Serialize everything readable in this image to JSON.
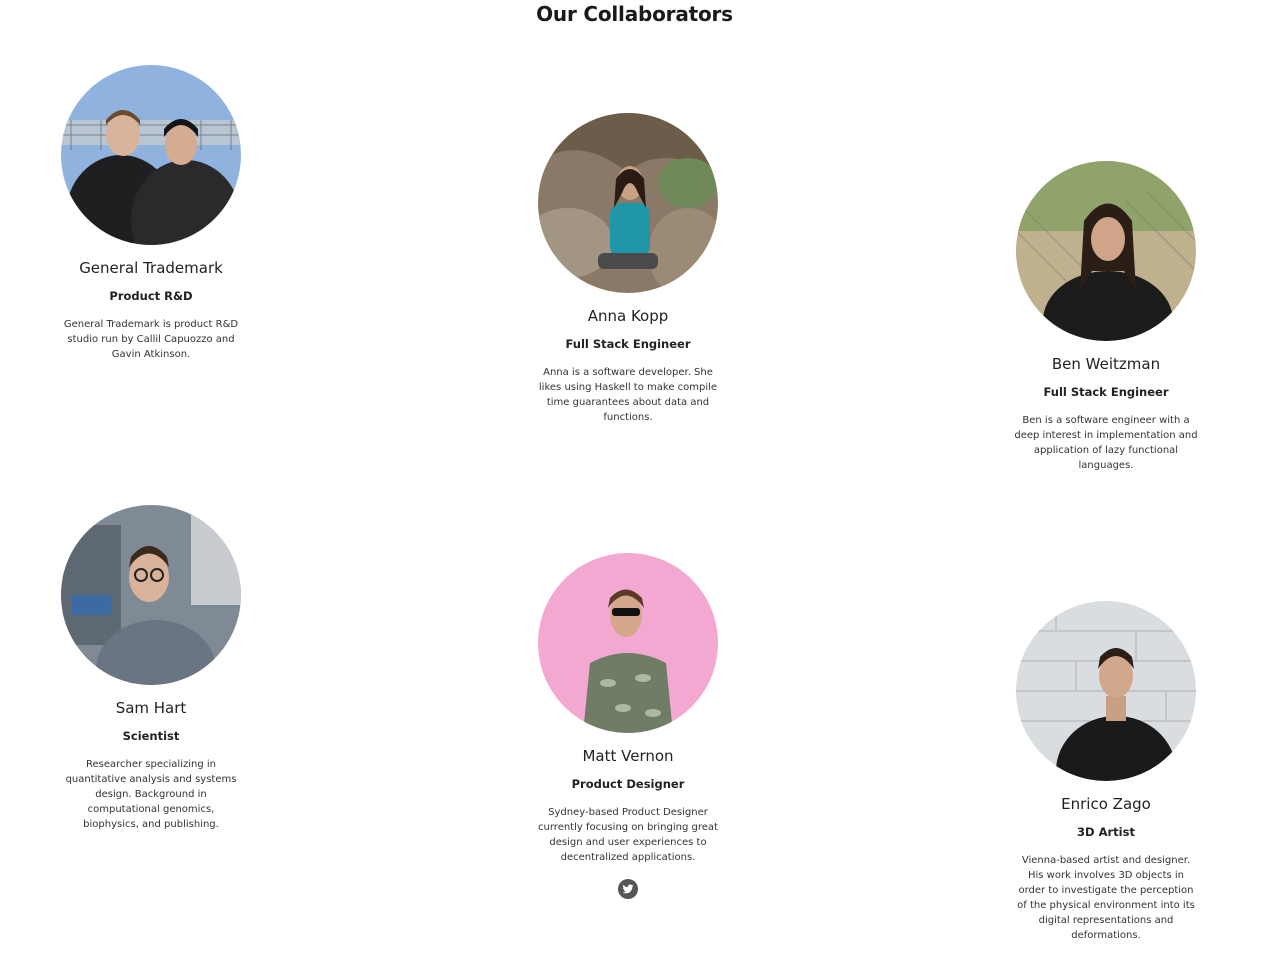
{
  "page": {
    "title": "Our Collaborators"
  },
  "collaborators": [
    {
      "name": "General Trademark",
      "role": "Product R&D",
      "bio": "General Trademark is product R&D studio run by Callil Capuozzo and Gavin Atkinson.",
      "photo": {
        "bg": "#7ea6d6",
        "accent": "#2a2a2a"
      }
    },
    {
      "name": "Anna Kopp",
      "role": "Full Stack Engineer",
      "bio": "Anna is a software developer. She likes using Haskell to make compile time guarantees about data and functions.",
      "photo": {
        "bg": "#8d7c6a",
        "accent": "#1f8f9e"
      }
    },
    {
      "name": "Ben Weitzman",
      "role": "Full Stack Engineer",
      "bio": "Ben is a software engineer with a deep interest in implementation and application of lazy functional languages.",
      "photo": {
        "bg": "#b7a888",
        "accent": "#2a2a2a"
      }
    },
    {
      "name": "Sam Hart",
      "role": "Scientist",
      "bio": "Researcher specializing in quantitative analysis and systems design. Background in computational genomics, biophysics, and publishing.",
      "photo": {
        "bg": "#7e8791",
        "accent": "#6f7a86"
      }
    },
    {
      "name": "Matt Vernon",
      "role": "Product Designer",
      "bio": "Sydney-based Product Designer currently focusing on bringing great design and user experiences to decentralized applications.",
      "photo": {
        "bg": "#f2a6d0",
        "accent": "#6f7d66"
      },
      "social": "twitter-icon"
    },
    {
      "name": "Enrico Zago",
      "role": "3D Artist",
      "bio": "Vienna-based artist and designer. His work involves 3D objects in order to investigate the perception of the physical environment into its digital representations and deformations.",
      "photo": {
        "bg": "#d9dcdf",
        "accent": "#1c1c1c"
      }
    }
  ]
}
